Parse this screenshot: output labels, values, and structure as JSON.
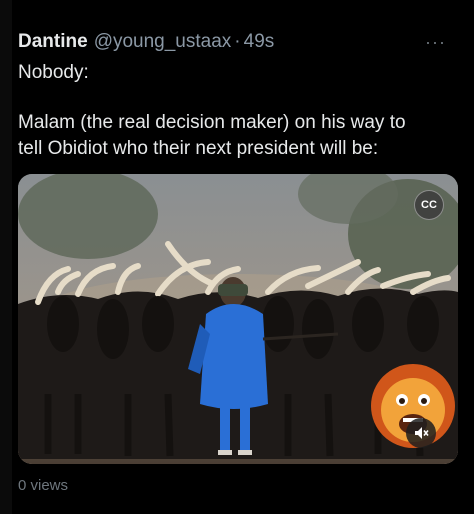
{
  "tweet": {
    "display_name": "Dantine",
    "handle": "@young_ustaax",
    "separator": "·",
    "timestamp": "49s",
    "line1": "Nobody:",
    "line2": "Malam (the real decision maker) on his way to",
    "line3": "tell  Obidiot who their next president will be:"
  },
  "media": {
    "captions_label": "CC",
    "sound_icon": "speaker-muted-icon",
    "more_icon": "more-dots-icon"
  },
  "footer": {
    "views": "0 views"
  },
  "colors": {
    "background": "#000000",
    "text": "#e7e9ea",
    "muted": "#8b98a5",
    "robe": "#2a6fd6"
  }
}
